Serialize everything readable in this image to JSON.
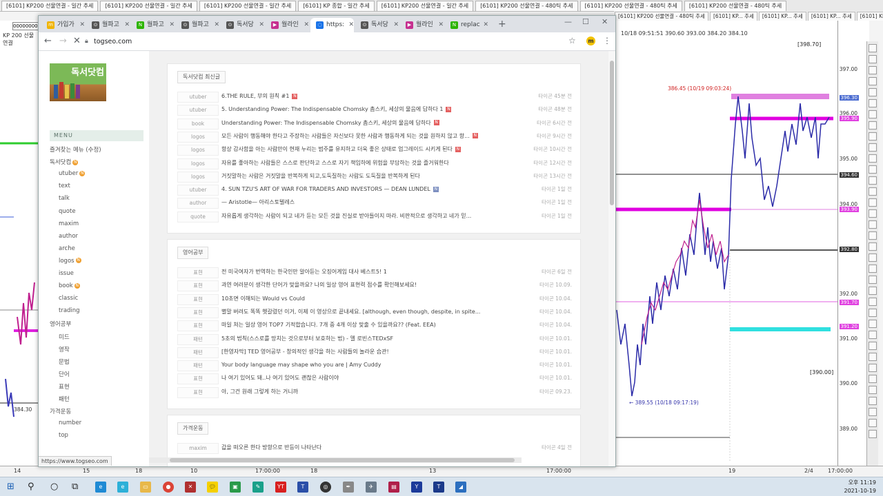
{
  "trading": {
    "top_tabs": [
      "[6101] KP200 선물연결 - 일간 추세",
      "[6101] KP200 선물연결 - 일간 추세",
      "[6101] KP200 선물연결 - 일간 추세",
      "[6101] KP 종합 - 일간 추세",
      "[6101] KP200 선물연결 - 일간 추세",
      "[6101] KP200 선물연결 - 480틱 추세",
      "[6101] KP200 선물연결 - 480틱 추세",
      "[6101] KP200 선물연결 - 480틱 추세"
    ],
    "sub_tabs": [
      "[6101] KP200 선물연결 - 480틱 추세",
      "[6101] KP... 추세",
      "[6101] KP... 추세",
      "[6101] KP... 추세",
      "[6101] KP... 추세"
    ],
    "left_input": "00000000",
    "left_label": "KP 200 선물연결",
    "chart_header": "10/18 09:51:51  390.60  393.00  384.20  384.10",
    "box_top": "[398.70]",
    "box_bottom": "[390.00]",
    "min_label": "← 389.55 (10/18 09:17:19)",
    "max_label": "386.45 (10/19 09:03:24)",
    "axis_labels": [
      "397.00",
      "396.00",
      "395.00",
      "394.00",
      "393.00",
      "392.00",
      "391.00",
      "390.00",
      "389.00"
    ],
    "axis_boxes": [
      {
        "text": "396.30",
        "color": "#4a6bd0"
      },
      {
        "text": "395.90",
        "color": "#e040e0"
      },
      {
        "text": "394.60",
        "color": "#333333"
      },
      {
        "text": "393.90",
        "color": "#e040e0"
      },
      {
        "text": "392.80",
        "color": "#333333"
      },
      {
        "text": "391.70",
        "color": "#e040e0"
      },
      {
        "text": "391.20",
        "color": "#e040e0"
      }
    ],
    "left_price": "384.30",
    "bottom_scale": [
      "14",
      "15",
      "18",
      "10",
      "17:00:00",
      "18",
      "13",
      "17:00:00",
      "19",
      "17:00:00"
    ],
    "page_indicator": "2/4"
  },
  "browser": {
    "tabs": [
      {
        "label": "가입가",
        "icon": "m",
        "color": "#f0b400"
      },
      {
        "label": "월파고",
        "icon": "⊙",
        "color": "#555555"
      },
      {
        "label": "월파고",
        "icon": "N",
        "color": "#2db400"
      },
      {
        "label": "월파고",
        "icon": "⊙",
        "color": "#555555"
      },
      {
        "label": "독서당",
        "icon": "⊙",
        "color": "#555555"
      },
      {
        "label": "월라인",
        "icon": "▶",
        "color": "#c62f8f"
      },
      {
        "label": "https:",
        "icon": "◌",
        "color": "#1a73e8"
      },
      {
        "label": "독서당",
        "icon": "⊙",
        "color": "#555555"
      },
      {
        "label": "월라인",
        "icon": "▶",
        "color": "#c62f8f"
      },
      {
        "label": "replac",
        "icon": "N",
        "color": "#2db400"
      }
    ],
    "url": "togseo.com",
    "status_url": "https://www.togseo.com"
  },
  "site": {
    "logo_text": "독서닷컴",
    "menu_title": "MENU",
    "menu": [
      {
        "label": "즐겨찾는 메뉴 (수정)",
        "indent": 0,
        "new": false
      },
      {
        "label": "독서닷컴",
        "indent": 0,
        "new": true
      },
      {
        "label": "utuber",
        "indent": 1,
        "new": true
      },
      {
        "label": "text",
        "indent": 1,
        "new": false
      },
      {
        "label": "talk",
        "indent": 1,
        "new": false
      },
      {
        "label": "quote",
        "indent": 1,
        "new": false
      },
      {
        "label": "maxim",
        "indent": 1,
        "new": false
      },
      {
        "label": "author",
        "indent": 1,
        "new": false
      },
      {
        "label": "arche",
        "indent": 1,
        "new": false
      },
      {
        "label": "logos",
        "indent": 1,
        "new": true
      },
      {
        "label": "issue",
        "indent": 1,
        "new": false
      },
      {
        "label": "book",
        "indent": 1,
        "new": true
      },
      {
        "label": "classic",
        "indent": 1,
        "new": false
      },
      {
        "label": "trading",
        "indent": 1,
        "new": false
      },
      {
        "label": "영어공부",
        "indent": 0,
        "new": false
      },
      {
        "label": "미드",
        "indent": 1,
        "new": false
      },
      {
        "label": "영작",
        "indent": 1,
        "new": false
      },
      {
        "label": "문법",
        "indent": 1,
        "new": false
      },
      {
        "label": "단어",
        "indent": 1,
        "new": false
      },
      {
        "label": "표현",
        "indent": 1,
        "new": false
      },
      {
        "label": "패턴",
        "indent": 1,
        "new": false
      },
      {
        "label": "가격운동",
        "indent": 0,
        "new": false
      },
      {
        "label": "number",
        "indent": 1,
        "new": false
      },
      {
        "label": "top",
        "indent": 1,
        "new": false
      }
    ],
    "panels": [
      {
        "title": "독서닷컴 최신글",
        "rows": [
          {
            "cat": "utuber",
            "title": "6.THE RULE, 부의 원칙 #1",
            "flag": "red",
            "meta": "타이곤  45분 전"
          },
          {
            "cat": "utuber",
            "title": "5. Understanding Power: The Indispensable Chomsky 촘스키, 세상의 물음에 답하다 1",
            "flag": "red",
            "meta": "타이곤  48분 전"
          },
          {
            "cat": "book",
            "title": "Understanding Power: The Indispensable Chomsky 촘스키, 세상의 물음에 답하다",
            "flag": "red",
            "meta": "타이곤  6시간 전"
          },
          {
            "cat": "logos",
            "title": "모든 사람이 행동해야 한다고 주장하는 사람들은 자신보다 못한 사람과 행동하게 되는 것을 원하지 않고 항...",
            "flag": "red",
            "meta": "타이곤  9시간 전"
          },
          {
            "cat": "logos",
            "title": "항상 감사함을 아는 사람만이 현재 누리는 범주를 유지하고 더욱 좋은 상태로 업그레이드 시키게 된다",
            "flag": "red",
            "meta": "타이곤  10시간 전"
          },
          {
            "cat": "logos",
            "title": "자유를 좋아하는 사람들은 스스로 판단하고 스스로 자기 책임하에 위험을 부담하는 것을 즐거워한다",
            "flag": "",
            "meta": "타이곤  12시간 전"
          },
          {
            "cat": "logos",
            "title": "거짓말하는 사람은 거짓말을 반복하게 되고,도둑질하는 사람도 도둑질을 반복하게 된다",
            "flag": "",
            "meta": "타이곤  13시간 전"
          },
          {
            "cat": "utuber",
            "title": "4. SUN TZU'S ART OF WAR FOR TRADERS AND INVESTORS — DEAN LUNDEL",
            "flag": "blue",
            "meta": "타이곤  1일 전"
          },
          {
            "cat": "author",
            "title": "— Aristotle— 아리스토텔레스",
            "flag": "",
            "meta": "타이곤  1일 전"
          },
          {
            "cat": "quote",
            "title": "자유롭게 생각하는 사람이 되고 네가 듣는 모든 것을 진실로 받아들이지 마라. 비판적으로 생각하고 네가 믿...",
            "flag": "",
            "meta": "타이곤  1일 전"
          }
        ]
      },
      {
        "title": "영어공부",
        "rows": [
          {
            "cat": "표현",
            "title": "전 미국여자가 번역하는 한국인만 알아듣는 오징어게임 대사 베스트5! 1",
            "flag": "",
            "meta": "타이곤  6일 전"
          },
          {
            "cat": "표현",
            "title": "과연 여러분이 생각한 단어가 맞을까요? 나의 일상 영어 표현력 점수를 확인해보세요!",
            "flag": "",
            "meta": "타이곤  10.09."
          },
          {
            "cat": "표현",
            "title": "10초면 이해되는 Would vs Could",
            "flag": "",
            "meta": "타이곤  10.04."
          },
          {
            "cat": "표현",
            "title": "별말 버려도 똑똑 헷갈렸던 이거, 이제 이 영상으로 끝내세요. [although, even though, despite, in spite...",
            "flag": "",
            "meta": "타이곤  10.04."
          },
          {
            "cat": "표현",
            "title": "마일 쳐는 일상 영어 TOP7 기적합습니다. 7개 중 4개 이상 맞출 수 있을까요?? (Feat. EEA)",
            "flag": "",
            "meta": "타이곤  10.04."
          },
          {
            "cat": "패턴",
            "title": "5초의 법칙(스스로를 망치는 것으로부터 보호하는 법) - 멜 로빈스TEDxSF",
            "flag": "",
            "meta": "타이곤  10.01."
          },
          {
            "cat": "패턴",
            "title": "[한영자막] TED 영어공부 - 창의적인 생각을 하는 사람들의 놀라운 습관!",
            "flag": "",
            "meta": "타이곤  10.01."
          },
          {
            "cat": "패턴",
            "title": "Your body language may shape who you are | Amy Cuddy",
            "flag": "",
            "meta": "타이곤  10.01."
          },
          {
            "cat": "표현",
            "title": "나 여기 있어도 돼..나 여기 있어도 괜찮은 사람이야",
            "flag": "",
            "meta": "타이곤  10.01."
          },
          {
            "cat": "표현",
            "title": "아, 그건 원래 그렇게 하는 거니까",
            "flag": "",
            "meta": "타이곤  09.23."
          }
        ]
      },
      {
        "title": "가격운동",
        "rows": [
          {
            "cat": "maxim",
            "title": "값을 떠오른 한다 방향으로 반등이 나타난다",
            "flag": "",
            "meta": "타이곤  4일 전"
          }
        ]
      }
    ]
  },
  "taskbar": {
    "time": "오후 11:19",
    "date": "2021-10-19"
  }
}
